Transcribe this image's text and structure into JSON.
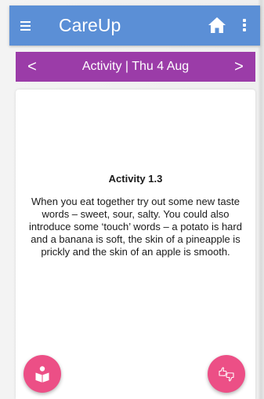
{
  "app": {
    "title": "CareUp",
    "colors": {
      "app_bar": "#5b8fd6",
      "date_bar": "#9b3ca8",
      "fab": "#ec4f86",
      "card": "#ffffff",
      "text": "#1a1a1a"
    }
  },
  "header": {
    "menu_icon": "hamburger-menu-icon",
    "home_icon": "home-icon",
    "more_icon": "more-vertical-icon"
  },
  "date_bar": {
    "prev_glyph": "<",
    "label": "Activity | Thu 4 Aug",
    "next_glyph": ">"
  },
  "activity": {
    "title": "Activity 1.3",
    "body": "When you eat together try out some new taste words – sweet, sour, salty. You could also introduce some ‘touch’ words – a potato is hard and a banana is soft, the skin of a pineapple is prickly and the skin of an apple is smooth."
  },
  "fabs": {
    "left_icon": "book-reader-icon",
    "right_icon": "thumbs-up-down-icon"
  }
}
